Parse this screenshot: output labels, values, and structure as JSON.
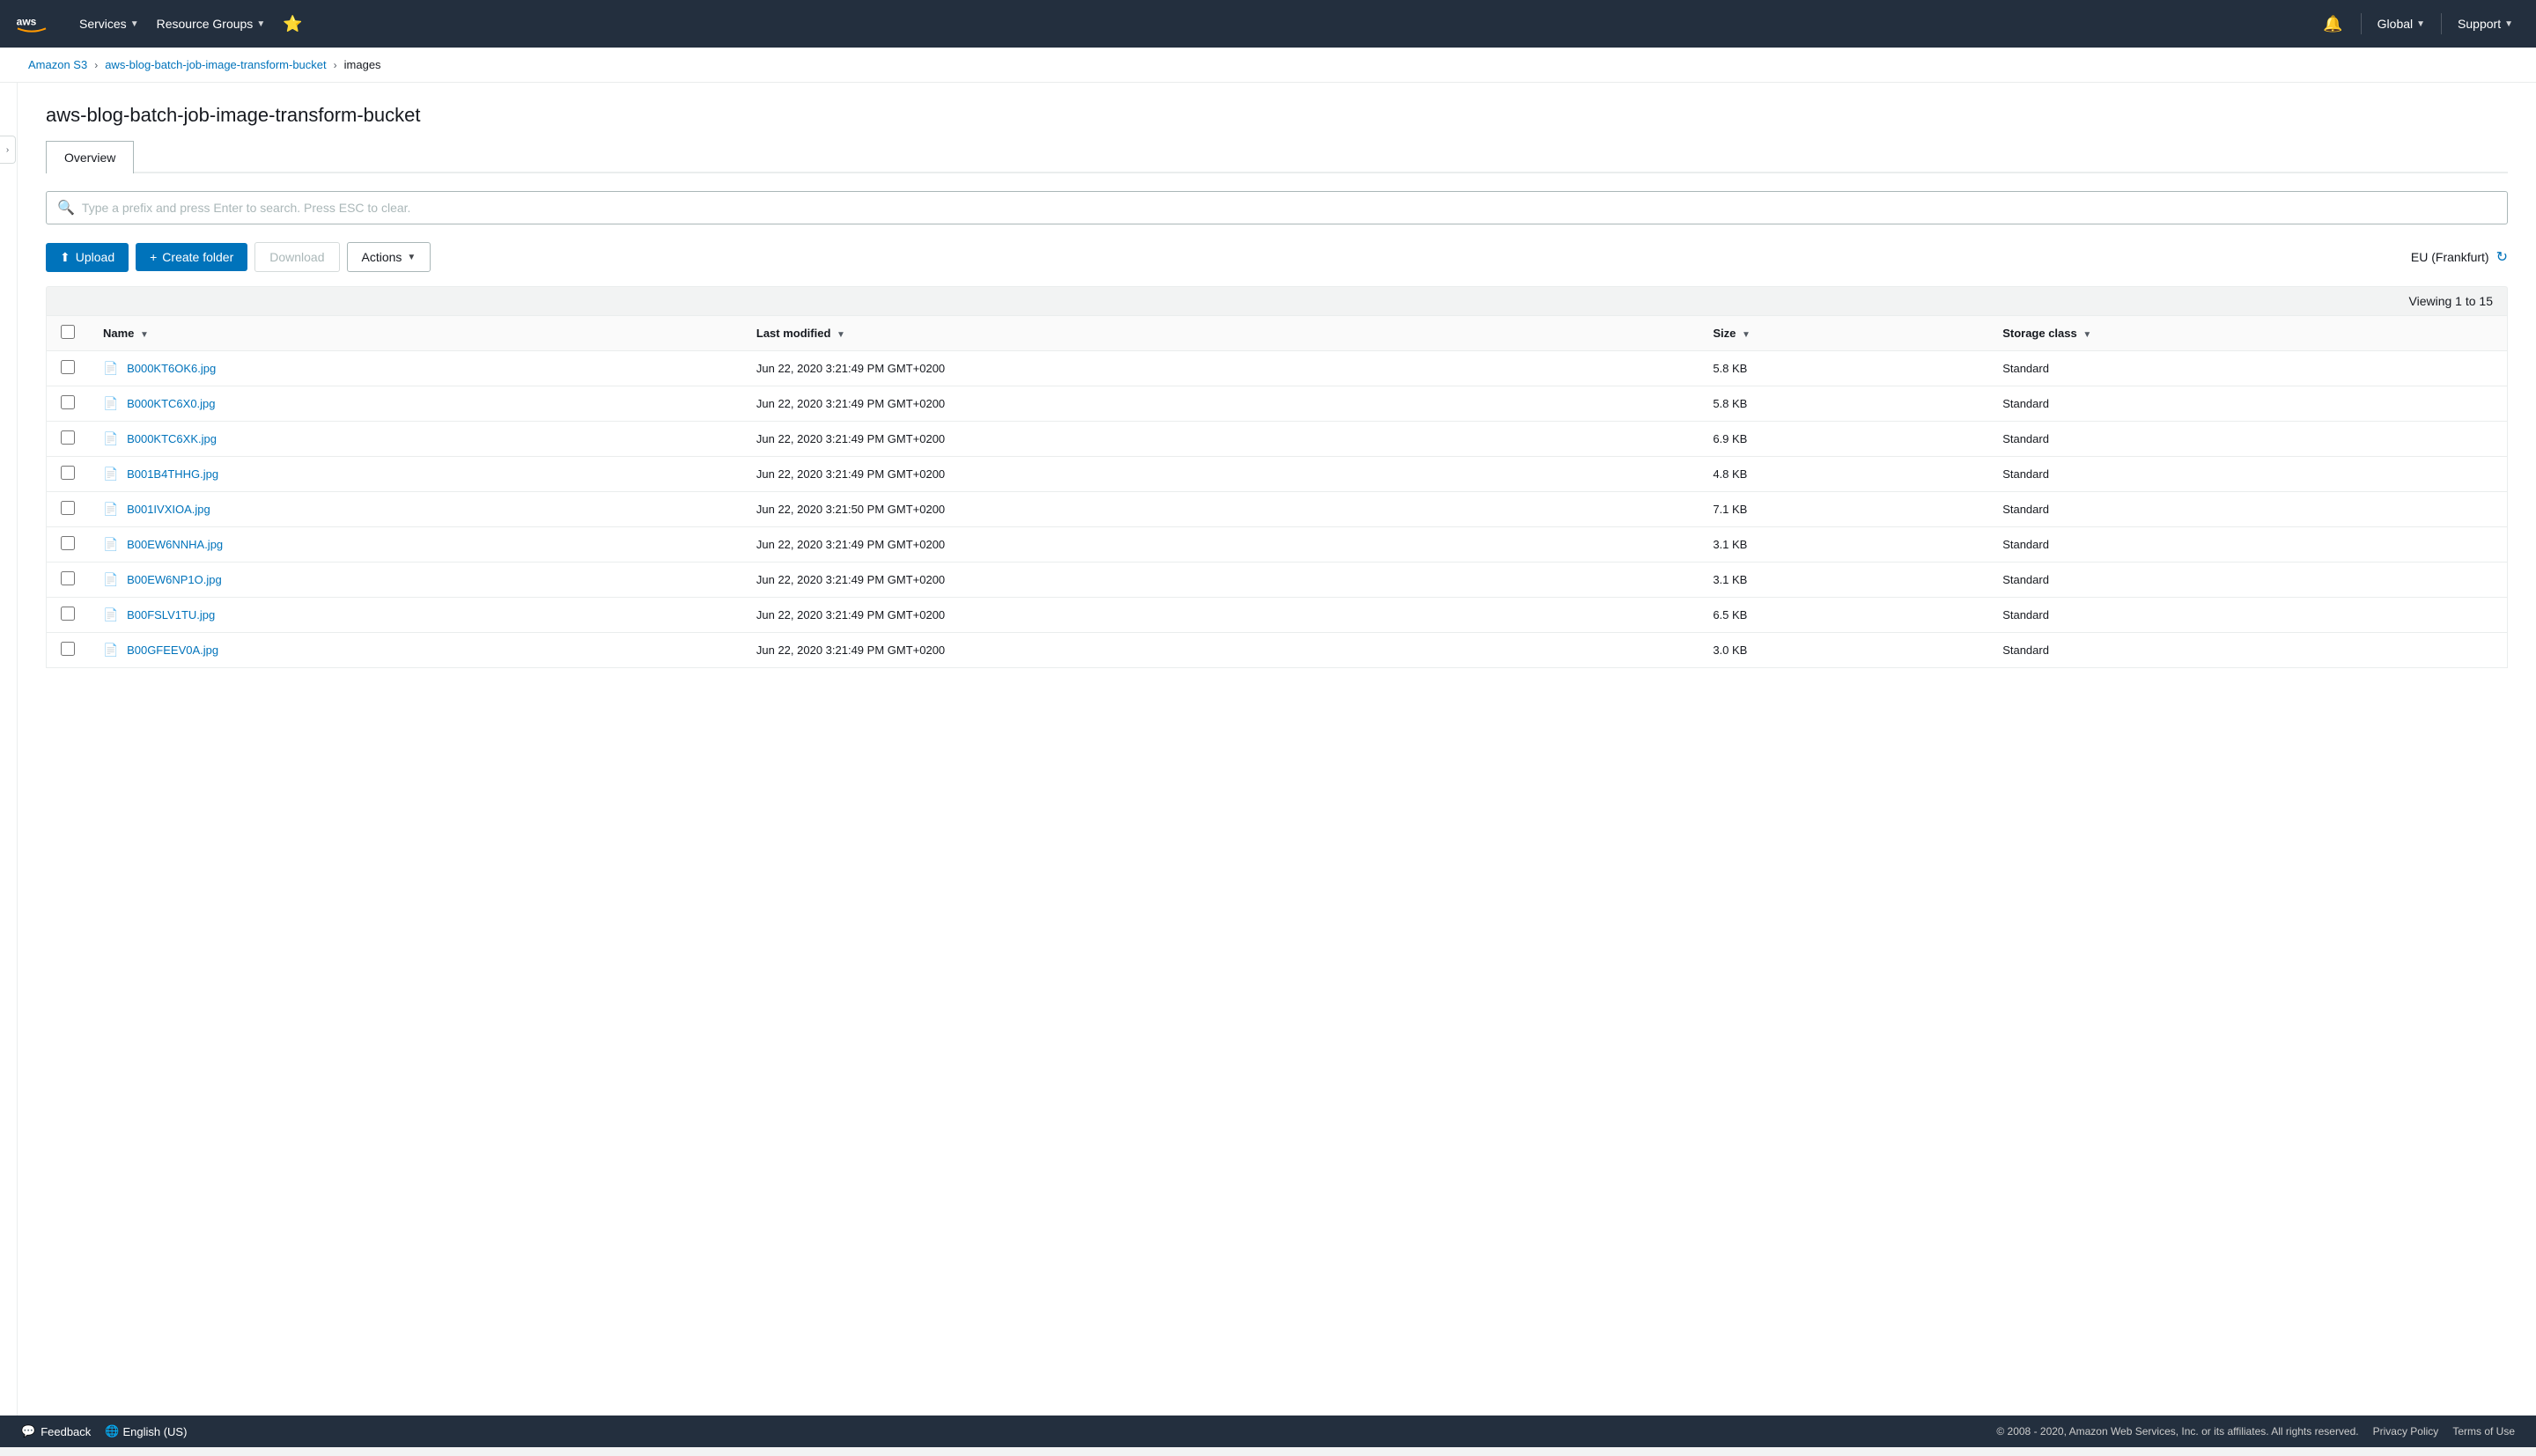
{
  "nav": {
    "services_label": "Services",
    "resource_groups_label": "Resource Groups",
    "global_label": "Global",
    "support_label": "Support"
  },
  "breadcrumb": {
    "s3_label": "Amazon S3",
    "bucket_label": "aws-blog-batch-job-image-transform-bucket",
    "folder_label": "images"
  },
  "page": {
    "title": "aws-blog-batch-job-image-transform-bucket",
    "tab_overview": "Overview"
  },
  "search": {
    "placeholder": "Type a prefix and press Enter to search. Press ESC to clear."
  },
  "actions": {
    "upload_label": "Upload",
    "create_folder_label": "Create folder",
    "download_label": "Download",
    "actions_label": "Actions",
    "region_label": "EU (Frankfurt)",
    "viewing_label": "Viewing 1 to 15"
  },
  "table": {
    "col_name": "Name",
    "col_modified": "Last modified",
    "col_size": "Size",
    "col_storage": "Storage class",
    "rows": [
      {
        "name": "B000KT6OK6.jpg",
        "modified": "Jun 22, 2020 3:21:49 PM GMT+0200",
        "size": "5.8 KB",
        "storage": "Standard"
      },
      {
        "name": "B000KTC6X0.jpg",
        "modified": "Jun 22, 2020 3:21:49 PM GMT+0200",
        "size": "5.8 KB",
        "storage": "Standard"
      },
      {
        "name": "B000KTC6XK.jpg",
        "modified": "Jun 22, 2020 3:21:49 PM GMT+0200",
        "size": "6.9 KB",
        "storage": "Standard"
      },
      {
        "name": "B001B4THHG.jpg",
        "modified": "Jun 22, 2020 3:21:49 PM GMT+0200",
        "size": "4.8 KB",
        "storage": "Standard"
      },
      {
        "name": "B001IVXIOA.jpg",
        "modified": "Jun 22, 2020 3:21:50 PM GMT+0200",
        "size": "7.1 KB",
        "storage": "Standard"
      },
      {
        "name": "B00EW6NNHA.jpg",
        "modified": "Jun 22, 2020 3:21:49 PM GMT+0200",
        "size": "3.1 KB",
        "storage": "Standard"
      },
      {
        "name": "B00EW6NP1O.jpg",
        "modified": "Jun 22, 2020 3:21:49 PM GMT+0200",
        "size": "3.1 KB",
        "storage": "Standard"
      },
      {
        "name": "B00FSLV1TU.jpg",
        "modified": "Jun 22, 2020 3:21:49 PM GMT+0200",
        "size": "6.5 KB",
        "storage": "Standard"
      },
      {
        "name": "B00GFEEV0A.jpg",
        "modified": "Jun 22, 2020 3:21:49 PM GMT+0200",
        "size": "3.0 KB",
        "storage": "Standard"
      }
    ]
  },
  "footer": {
    "feedback_label": "Feedback",
    "language_label": "English (US)",
    "copyright": "© 2008 - 2020, Amazon Web Services, Inc. or its affiliates. All rights reserved.",
    "privacy_label": "Privacy Policy",
    "terms_label": "Terms of Use"
  }
}
